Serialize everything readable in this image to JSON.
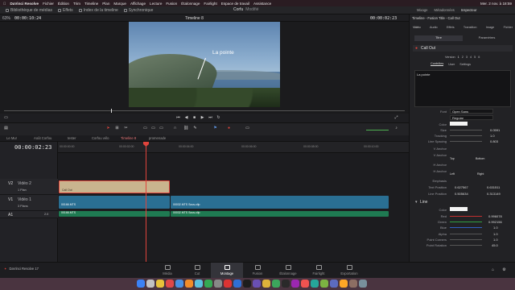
{
  "menubar": {
    "app": "DaVinci Resolve",
    "items": [
      "Fichier",
      "Édition",
      "Trim",
      "Timeline",
      "Plan",
      "Marque",
      "Affichage",
      "Lecture",
      "Fusion",
      "Étalonnage",
      "Fairlight",
      "Espace de travail",
      "Assistance"
    ],
    "clock": "Mer. 2 nov. à 18:59"
  },
  "toptools": {
    "items": [
      "Bibliothèque de médias",
      "Effets",
      "Index de la timeline",
      "Synchronique"
    ],
    "right_items": [
      "Mixage",
      "Métadonnées",
      "Inspecteur"
    ]
  },
  "project": {
    "name": "Corfu",
    "status": "Modifié"
  },
  "viewer": {
    "zoom": "63%",
    "source_tc": "00:00:10:24",
    "timeline_name": "Timeline 8",
    "record_tc": "00:00:02:23",
    "title_text": "La pointe"
  },
  "timeline_tabs": [
    "Le Mur",
    "Août Corfou",
    "tester",
    "Corfou vélo",
    "Timeline 8",
    "promenade"
  ],
  "timeline": {
    "current_tc": "00:00:02:23",
    "ruler": [
      "00:00:00:00",
      "00:00:02:00",
      "00:00:04:00",
      "00:00:06:00",
      "00:00:08:00",
      "00:00:10:00",
      "00:00:12:00",
      "00:00:14:00"
    ],
    "tracks": [
      {
        "id": "V2",
        "name": "Vidéo 2",
        "info": "1 Plan"
      },
      {
        "id": "V1",
        "name": "Vidéo 1",
        "info": "3 Plans"
      },
      {
        "id": "A1",
        "name": "",
        "info": "2.0"
      }
    ],
    "clips": {
      "title": "Call Out",
      "v1a": "00166.MTS",
      "v1b": "00032.MTS Sous-clip",
      "a1a": "00166.MTS",
      "a1b": "00032.MTS Sous-clip"
    }
  },
  "inspector": {
    "header": "Timeline - Fusion Title - Call Out",
    "tabs": [
      "Vidéo",
      "Audio",
      "Effets",
      "Transition",
      "Image",
      "Fichier"
    ],
    "subtabs": [
      "Titre",
      "Paramètres"
    ],
    "section": "Call Out",
    "version_label": "Version",
    "versions": [
      "1",
      "2",
      "3",
      "4",
      "5",
      "6"
    ],
    "ctrl_tabs": [
      "Contrôles",
      "User",
      "Settings"
    ],
    "text_value": "La pointe",
    "fields": {
      "font_label": "Font",
      "font_value": "Open Sans",
      "style_value": "Regular",
      "color_label": "Color",
      "size_label": "Size",
      "size_value": "0.0591",
      "tracking_label": "Tracking",
      "tracking_value": "1.0",
      "linespacing_label": "Line Spacing",
      "linespacing_value": "0.803",
      "vanchor_label": "V Anchor",
      "vanchor_opts": [
        "Top",
        "Bottom"
      ],
      "hanchor_label": "H Anchor",
      "hanchor2_label": "H Anchor",
      "hanchor_opts": [
        "Left",
        "Right"
      ],
      "emphasis_label": "Emphasis",
      "textpos_label": "Text Position",
      "textpos_x": "0.627567",
      "textpos_y": "0.631511",
      "linepos_label": "Line Position",
      "linepos_x": "0.505634",
      "linepos_y": "0.313149",
      "line_section": "Line",
      "red_label": "Red",
      "red_value": "0.996078",
      "green_label": "Green",
      "green_value": "0.992156",
      "blue_label": "Blue",
      "blue_value": "1.0",
      "alpha_label": "Alpha",
      "alpha_value": "1.0",
      "corners_label": "Point Corners",
      "corners_value": "1.0",
      "rotation_label": "Point Rotation",
      "rotation_value": "45.0"
    }
  },
  "pages": [
    "Média",
    "Cut",
    "Montage",
    "Fusion",
    "Étalonnage",
    "Fairlight",
    "Exportation"
  ],
  "pagebar": {
    "app_name": "DaVinci Resolve 17"
  },
  "colors": {
    "accent": "#e0443c",
    "title_clip": "#c9b48e",
    "video_clip": "#2a6f93",
    "audio_clip": "#1f7a52"
  }
}
